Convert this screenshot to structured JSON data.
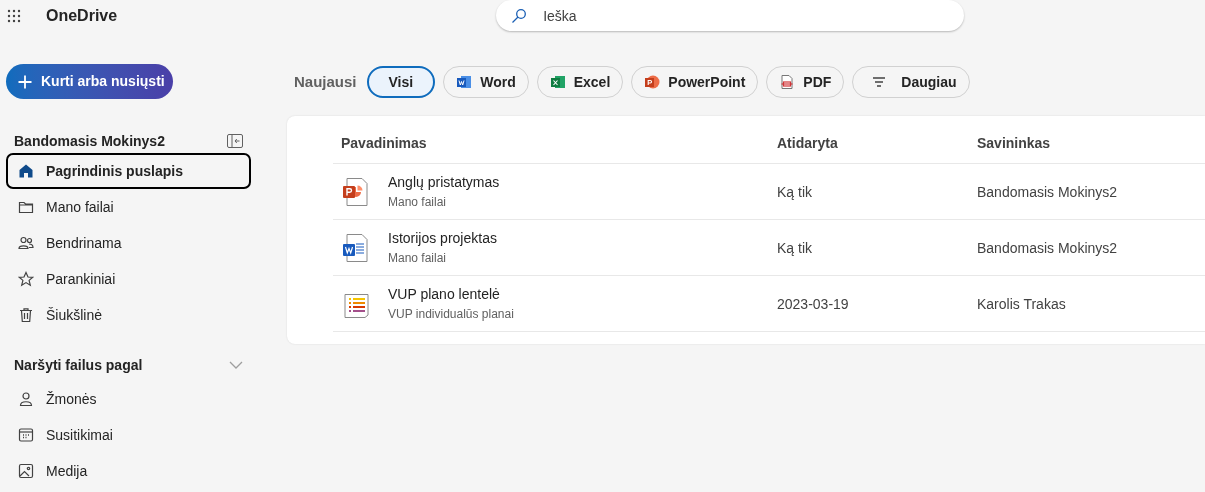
{
  "app": {
    "title": "OneDrive"
  },
  "search": {
    "placeholder": "Ieška"
  },
  "create_button": {
    "label": "Kurti arba nusiųsti"
  },
  "sidebar": {
    "account": "Bandomasis Mokinys2",
    "items": [
      {
        "label": "Pagrindinis puslapis",
        "kind": "home",
        "selected": true
      },
      {
        "label": "Mano failai",
        "kind": "folder",
        "selected": false
      },
      {
        "label": "Bendrinama",
        "kind": "people",
        "selected": false
      },
      {
        "label": "Parankiniai",
        "kind": "star",
        "selected": false
      },
      {
        "label": "Šiukšlinė",
        "kind": "trash",
        "selected": false
      }
    ],
    "browse": {
      "title": "Naršyti failus pagal",
      "expanded": true,
      "items": [
        {
          "label": "Žmonės",
          "kind": "person",
          "selected": false
        },
        {
          "label": "Susitikimai",
          "kind": "calendar",
          "selected": false
        },
        {
          "label": "Medija",
          "kind": "image",
          "selected": false
        }
      ]
    }
  },
  "filters": {
    "label": "Naujausi",
    "items": [
      {
        "label": "Visi",
        "kind": "all",
        "selected": true
      },
      {
        "label": "Word",
        "kind": "word",
        "selected": false
      },
      {
        "label": "Excel",
        "kind": "excel",
        "selected": false
      },
      {
        "label": "PowerPoint",
        "kind": "powerpoint",
        "selected": false
      },
      {
        "label": "PDF",
        "kind": "pdf",
        "selected": false
      },
      {
        "label": "Daugiau",
        "kind": "more",
        "selected": false
      }
    ]
  },
  "table": {
    "columns": [
      "Pavadinimas",
      "Atidaryta",
      "Savininkas"
    ],
    "rows": [
      {
        "kind": "powerpoint",
        "name": "Anglų pristatymas",
        "location": "Mano failai",
        "opened": "Ką tik",
        "owner": "Bandomasis Mokinys2"
      },
      {
        "kind": "word",
        "name": "Istorijos projektas",
        "location": "Mano failai",
        "opened": "Ką tik",
        "owner": "Bandomasis Mokinys2"
      },
      {
        "kind": "list",
        "name": "VUP plano lentelė",
        "location": "VUP individualūs planai",
        "opened": "2023-03-19",
        "owner": "Karolis Trakas"
      }
    ]
  }
}
